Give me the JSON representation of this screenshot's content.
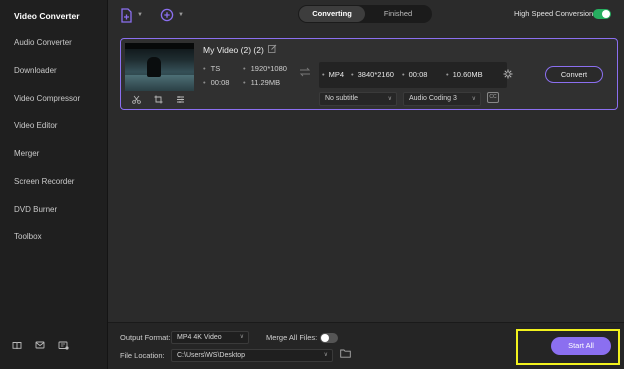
{
  "sidebar": {
    "items": [
      {
        "label": "Video Converter",
        "active": true
      },
      {
        "label": "Audio Converter",
        "active": false
      },
      {
        "label": "Downloader",
        "active": false
      },
      {
        "label": "Video Compressor",
        "active": false
      },
      {
        "label": "Video Editor",
        "active": false
      },
      {
        "label": "Merger",
        "active": false
      },
      {
        "label": "Screen Recorder",
        "active": false
      },
      {
        "label": "DVD Burner",
        "active": false
      },
      {
        "label": "Toolbox",
        "active": false
      }
    ],
    "bottom_icons": [
      "book-icon",
      "mail-icon",
      "feedback-icon"
    ]
  },
  "topbar": {
    "add_files_icon": "add-file-icon",
    "add_media_icon": "add-media-icon",
    "tabs": [
      {
        "label": "Converting",
        "active": true
      },
      {
        "label": "Finished",
        "active": false
      }
    ],
    "high_speed_label": "High Speed Conversion",
    "high_speed_on": true
  },
  "file": {
    "title": "My Video (2) (2)",
    "source": {
      "format": "TS",
      "resolution": "1920*1080",
      "duration": "00:08",
      "size": "11.29MB"
    },
    "output": {
      "format": "MP4",
      "resolution": "3840*2160",
      "duration": "00:08",
      "size": "10.60MB"
    },
    "convert_label": "Convert",
    "subtitle": "No subtitle",
    "audio": "Audio Coding 3"
  },
  "footer": {
    "output_format_label": "Output Format:",
    "output_format_value": "MP4 4K Video",
    "merge_label": "Merge All Files:",
    "merge_on": false,
    "file_location_label": "File Location:",
    "file_location_value": "C:\\Users\\WS\\Desktop",
    "start_all_label": "Start All"
  },
  "colors": {
    "accent": "#8b6ff0",
    "toggle_on": "#27ae60",
    "highlight": "#f2f21e",
    "background": "#2b2b2b",
    "sidebar": "#1f1f1f"
  }
}
